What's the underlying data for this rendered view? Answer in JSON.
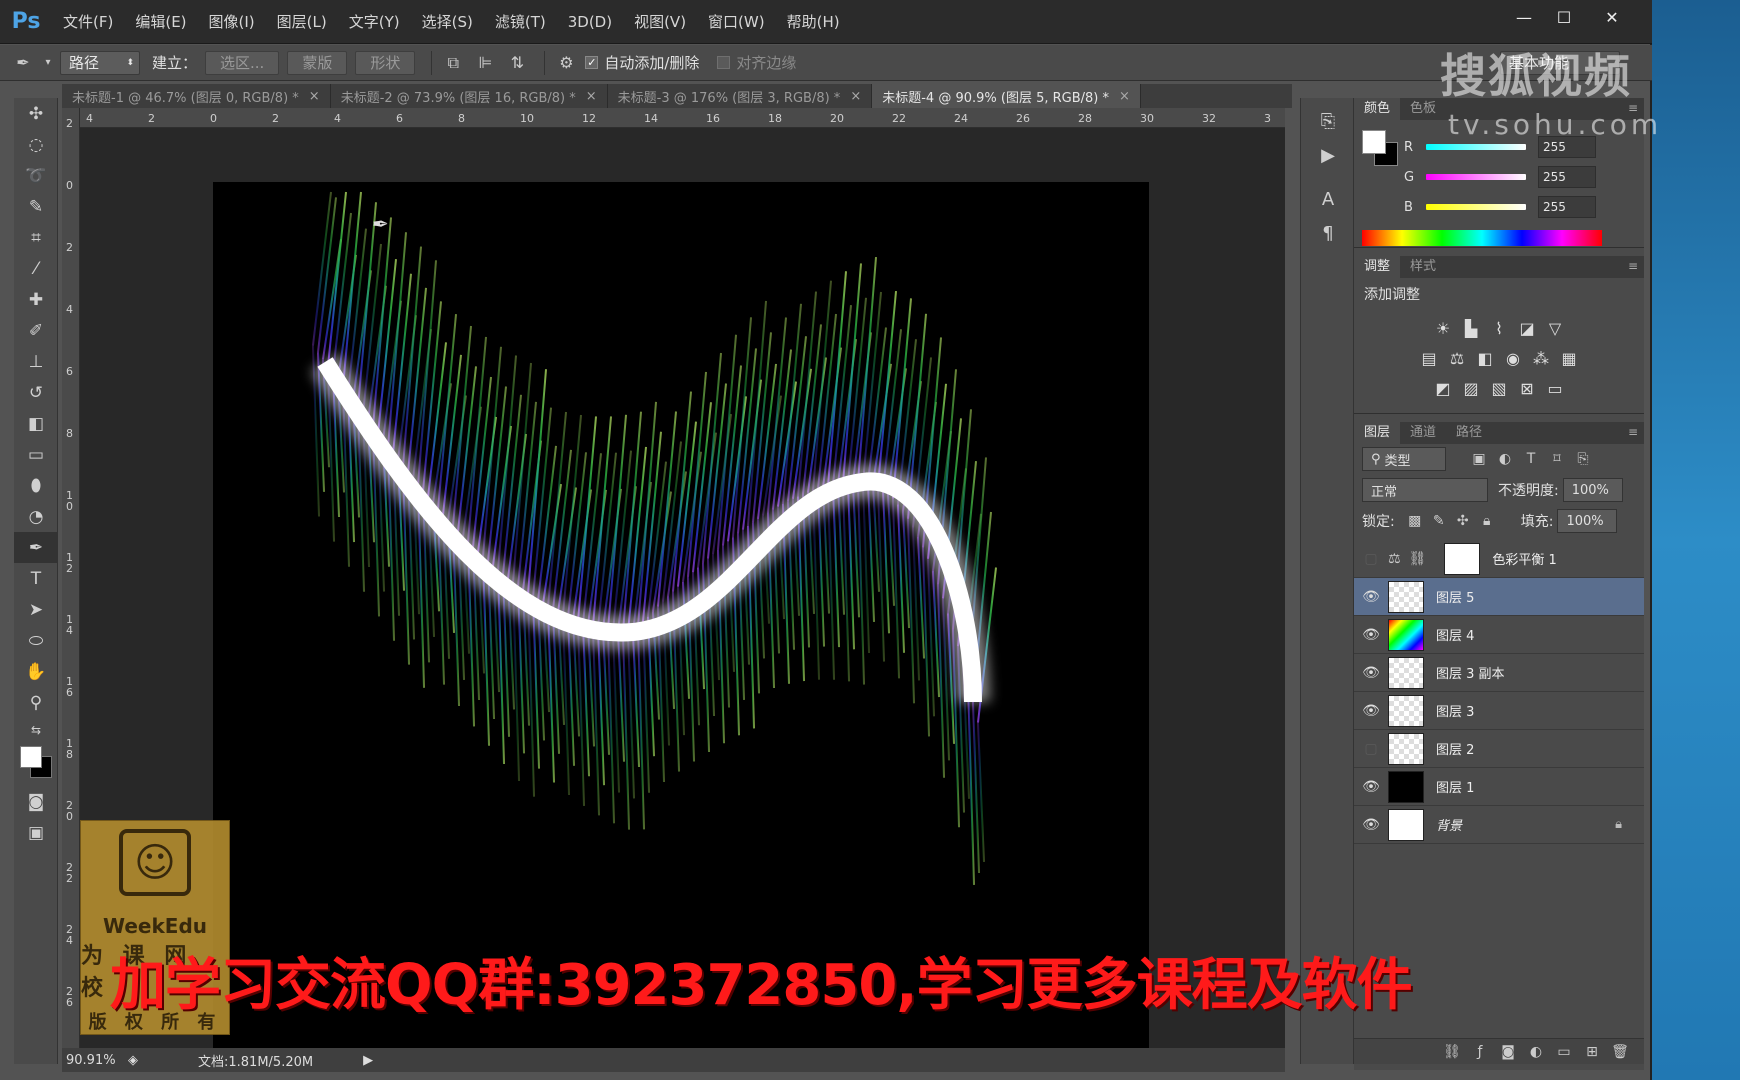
{
  "app": {
    "logo": "Ps",
    "menu": [
      "文件(F)",
      "编辑(E)",
      "图像(I)",
      "图层(L)",
      "文字(Y)",
      "选择(S)",
      "滤镜(T)",
      "3D(D)",
      "视图(V)",
      "窗口(W)",
      "帮助(H)"
    ],
    "window_buttons": [
      "—",
      "☐",
      "✕"
    ]
  },
  "options": {
    "mode": "路径",
    "create_label": "建立：",
    "buttons": [
      "选区...",
      "蒙版",
      "形状"
    ],
    "auto_add_label": "自动添加/删除",
    "auto_add_checked": true,
    "align_edges_label": "对齐边缘",
    "workspace": "基本功能"
  },
  "tabs": [
    {
      "label": "未标题-1 @ 46.7% (图层 0, RGB/8) *",
      "active": false
    },
    {
      "label": "未标题-2 @ 73.9% (图层 16, RGB/8) *",
      "active": false
    },
    {
      "label": "未标题-3 @ 176% (图层 3, RGB/8) *",
      "active": false
    },
    {
      "label": "未标题-4 @ 90.9% (图层 5, RGB/8) *",
      "active": true
    }
  ],
  "ruler_h": [
    "4",
    "2",
    "0",
    "2",
    "4",
    "6",
    "8",
    "10",
    "12",
    "14",
    "16",
    "18",
    "20",
    "22",
    "24",
    "26",
    "28",
    "30",
    "32",
    "3"
  ],
  "ruler_v": [
    "2",
    "0",
    "2",
    "4",
    "6",
    "8",
    "1\n0",
    "1\n2",
    "1\n4",
    "1\n6",
    "1\n8",
    "2\n0",
    "2\n2",
    "2\n4",
    "2\n6"
  ],
  "status": {
    "zoom": "90.91%",
    "doc": "文档:1.81M/5.20M"
  },
  "color_panel": {
    "tabs": [
      "颜色",
      "色板"
    ],
    "r": "255",
    "g": "255",
    "b": "255",
    "labels": [
      "R",
      "G",
      "B"
    ]
  },
  "adjustments": {
    "tabs": [
      "调整",
      "样式"
    ],
    "title": "添加调整"
  },
  "layers_panel": {
    "tabs": [
      "图层",
      "通道",
      "路径"
    ],
    "filter": "类型",
    "blend_mode": "正常",
    "opacity_label": "不透明度:",
    "opacity": "100%",
    "lock_label": "锁定:",
    "fill_label": "填充:",
    "fill": "100%",
    "layers": [
      {
        "name": "色彩平衡 1",
        "visible": false,
        "thumb": "white",
        "type": "adjustment",
        "selected": false
      },
      {
        "name": "图层 5",
        "visible": true,
        "thumb": "transparent",
        "selected": true
      },
      {
        "name": "图层 4",
        "visible": true,
        "thumb": "rainbow",
        "selected": false
      },
      {
        "name": "图层 3 副本",
        "visible": true,
        "thumb": "transparent",
        "selected": false
      },
      {
        "name": "图层 3",
        "visible": true,
        "thumb": "transparent",
        "selected": false
      },
      {
        "name": "图层 2",
        "visible": false,
        "thumb": "transparent",
        "selected": false
      },
      {
        "name": "图层 1",
        "visible": true,
        "thumb": "black",
        "selected": false
      },
      {
        "name": "背景",
        "visible": true,
        "thumb": "white",
        "locked": true,
        "selected": false
      }
    ]
  },
  "overlay": {
    "promo": "加学习交流QQ群:392372850,学习更多课程及软件",
    "logo_text": "WeekEdu",
    "logo_cn1": "为 课 网 校",
    "logo_cn2": "版 权 所 有",
    "sohu": "搜狐视频",
    "sohu_url": "tv.sohu.com"
  }
}
